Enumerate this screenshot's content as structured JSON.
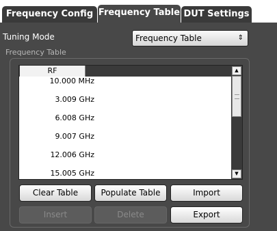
{
  "tabs": [
    "Frequency Config",
    "Frequency Table",
    "DUT Settings"
  ],
  "tuning": {
    "label": "Tuning Mode",
    "value": "Frequency Table"
  },
  "group_label": "Frequency Table",
  "table": {
    "column": "RF",
    "rows": [
      "10.000 MHz",
      "3.009 GHz",
      "6.008 GHz",
      "9.007 GHz",
      "12.006 GHz",
      "15.005 GHz"
    ]
  },
  "buttons": {
    "clear": "Clear Table",
    "populate": "Populate Table",
    "import": "Import",
    "insert": "Insert",
    "delete": "Delete",
    "export": "Export"
  }
}
